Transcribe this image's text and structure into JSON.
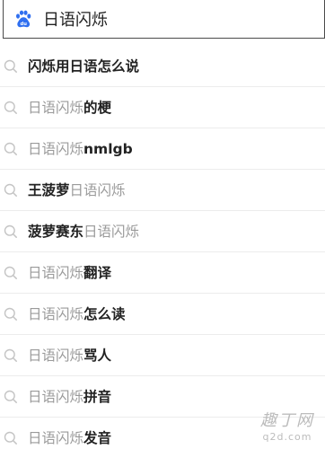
{
  "search": {
    "logo_icon": "baidu-paw-icon",
    "query": "日语闪烁",
    "brand_color": "#2f6ff0"
  },
  "suggestions": [
    {
      "parts": [
        {
          "text": "闪烁用日语怎么说",
          "style": "hl"
        }
      ]
    },
    {
      "parts": [
        {
          "text": "日语闪烁",
          "style": "dim"
        },
        {
          "text": "的梗",
          "style": "hl"
        }
      ]
    },
    {
      "parts": [
        {
          "text": "日语闪烁",
          "style": "dim"
        },
        {
          "text": "nmlgb",
          "style": "hl"
        }
      ]
    },
    {
      "parts": [
        {
          "text": "王菠萝",
          "style": "hl"
        },
        {
          "text": "日语闪烁",
          "style": "dim"
        }
      ]
    },
    {
      "parts": [
        {
          "text": "菠萝赛东",
          "style": "hl"
        },
        {
          "text": "日语闪烁",
          "style": "dim"
        }
      ]
    },
    {
      "parts": [
        {
          "text": "日语闪烁",
          "style": "dim"
        },
        {
          "text": "翻译",
          "style": "hl"
        }
      ]
    },
    {
      "parts": [
        {
          "text": "日语闪烁",
          "style": "dim"
        },
        {
          "text": "怎么读",
          "style": "hl"
        }
      ]
    },
    {
      "parts": [
        {
          "text": "日语闪烁",
          "style": "dim"
        },
        {
          "text": "骂人",
          "style": "hl"
        }
      ]
    },
    {
      "parts": [
        {
          "text": "日语闪烁",
          "style": "dim"
        },
        {
          "text": "拼音",
          "style": "hl"
        }
      ]
    },
    {
      "parts": [
        {
          "text": "日语闪烁",
          "style": "dim"
        },
        {
          "text": "发音",
          "style": "hl"
        }
      ]
    }
  ],
  "suggestion_icon": "search-icon",
  "watermark": {
    "main": "趣丁网",
    "sub": "q2d.com"
  }
}
